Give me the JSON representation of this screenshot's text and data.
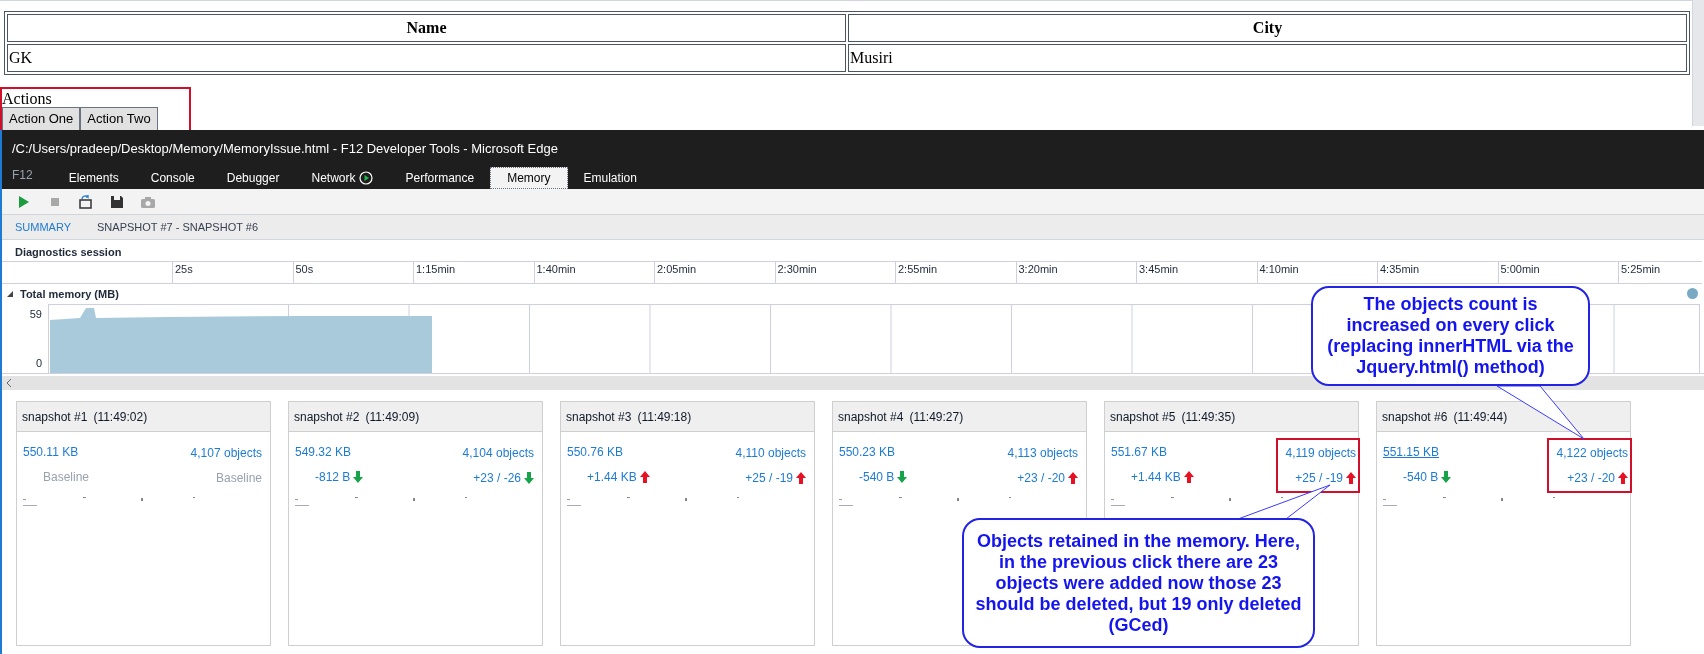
{
  "page_table": {
    "columns": [
      "Name",
      "City"
    ],
    "rows": [
      [
        "GK",
        "Musiri"
      ]
    ]
  },
  "actions": {
    "label": "Actions",
    "buttons": [
      "Action One",
      "Action Two"
    ]
  },
  "devtools": {
    "title": "/C:/Users/pradeep/Desktop/Memory/MemoryIssue.html - F12 Developer Tools - Microsoft Edge",
    "f12_label": "F12",
    "tabs": [
      {
        "label": "Elements",
        "selected": false,
        "recording": false
      },
      {
        "label": "Console",
        "selected": false,
        "recording": false
      },
      {
        "label": "Debugger",
        "selected": false,
        "recording": false
      },
      {
        "label": "Network",
        "selected": false,
        "recording": true
      },
      {
        "label": "Performance",
        "selected": false,
        "recording": false
      },
      {
        "label": "Memory",
        "selected": true,
        "recording": false
      },
      {
        "label": "Emulation",
        "selected": false,
        "recording": false
      }
    ],
    "toolbar": [
      {
        "kind": "play",
        "disabled": false
      },
      {
        "kind": "stop",
        "disabled": true
      },
      {
        "kind": "import",
        "disabled": false
      },
      {
        "kind": "save",
        "disabled": false
      },
      {
        "kind": "camera",
        "disabled": true
      }
    ],
    "subtabs": [
      {
        "label": "SUMMARY",
        "selected": true
      },
      {
        "label": "SNAPSHOT #7 - SNAPSHOT #6",
        "selected": false
      }
    ],
    "session_label": "Diagnostics session",
    "timeline_labels": [
      "25s",
      "50s",
      "1:15min",
      "1:40min",
      "2:05min",
      "2:30min",
      "2:55min",
      "3:20min",
      "3:45min",
      "4:10min",
      "4:35min",
      "5:00min",
      "5:25min"
    ],
    "memory_chart": {
      "title": "Total memory (MB)",
      "expanded": true,
      "max_label": "59",
      "min_label": "0"
    },
    "snapshots": [
      {
        "title": "snapshot #1",
        "time": "(11:49:02)",
        "size": "550.11 KB",
        "objects": "4,107 objects",
        "size_delta": "Baseline",
        "objects_delta": "Baseline",
        "baseline": true,
        "underlined": false,
        "highlighted": false
      },
      {
        "title": "snapshot #2",
        "time": "(11:49:09)",
        "size": "549.32 KB",
        "objects": "4,104 objects",
        "size_delta": "-812 B",
        "objects_delta": "+23 / -26",
        "baseline": false,
        "size_up": false,
        "objects_up": false,
        "underlined": false,
        "highlighted": false
      },
      {
        "title": "snapshot #3",
        "time": "(11:49:18)",
        "size": "550.76 KB",
        "objects": "4,110 objects",
        "size_delta": "+1.44 KB",
        "objects_delta": "+25 / -19",
        "baseline": false,
        "size_up": true,
        "objects_up": true,
        "underlined": false,
        "highlighted": false
      },
      {
        "title": "snapshot #4",
        "time": "(11:49:27)",
        "size": "550.23 KB",
        "objects": "4,113 objects",
        "size_delta": "-540 B",
        "objects_delta": "+23 / -20",
        "baseline": false,
        "size_up": false,
        "objects_up": true,
        "underlined": false,
        "highlighted": false
      },
      {
        "title": "snapshot #5",
        "time": "(11:49:35)",
        "size": "551.67 KB",
        "objects": "4,119 objects",
        "size_delta": "+1.44 KB",
        "objects_delta": "+25 / -19",
        "baseline": false,
        "size_up": true,
        "objects_up": true,
        "underlined": false,
        "highlighted": true
      },
      {
        "title": "snapshot #6",
        "time": "(11:49:44)",
        "size": "551.15 KB",
        "objects": "4,122 objects",
        "size_delta": "-540 B",
        "objects_delta": "+23 / -20",
        "baseline": false,
        "size_up": false,
        "objects_up": true,
        "underlined": true,
        "highlighted": true
      }
    ]
  },
  "callouts": [
    "The objects count is increased on every click (replacing innerHTML via the Jquery.html() method)",
    "Objects retained in the memory. Here, in the previous click there are 23 objects were added now those 23 should be deleted, but 19 only deleted (GCed)"
  ]
}
